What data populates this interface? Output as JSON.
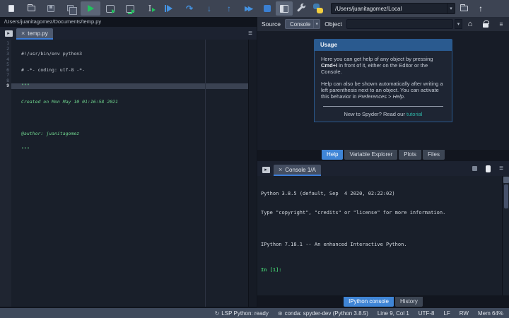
{
  "icons": {
    "dropdown": "▾",
    "menu": "≡",
    "home": "⌂",
    "close": "×",
    "curved_arrow": "↷",
    "arrow_down": "↓",
    "arrow_up": "↑",
    "fast_forward": "▶▶",
    "ibeam": "I",
    "browse_arrow": "▸",
    "lsp": "↻",
    "conda": "⊛"
  },
  "toolbar": {
    "path_value": "/Users/juanitagomez/Local"
  },
  "editor": {
    "path": "/Users/juanitagomez/Documents/temp.py",
    "tab_label": "temp.py",
    "lines": [
      {
        "num": "1",
        "text": "#!/usr/bin/env python3"
      },
      {
        "num": "2",
        "text": "# -*- coding: utf-8 -*-"
      },
      {
        "num": "3",
        "text": "\"\"\""
      },
      {
        "num": "4",
        "text": "Created on Mon May 10 01:16:58 2021"
      },
      {
        "num": "5",
        "text": ""
      },
      {
        "num": "6",
        "text": "@author: juanitagomez"
      },
      {
        "num": "7",
        "text": "\"\"\""
      },
      {
        "num": "8",
        "text": ""
      },
      {
        "num": "9",
        "text": ""
      }
    ]
  },
  "help": {
    "source_label": "Source",
    "source_value": "Console",
    "object_label": "Object",
    "usage": {
      "title": "Usage",
      "p1_before": "Here you can get help of any object by pressing ",
      "p1_bold": "Cmd+I",
      "p1_after": " in front of it, either on the Editor or the Console.",
      "p2_before": "Help can also be shown automatically after writing a left parenthesis next to an object. You can activate this behavior in ",
      "p2_italic": "Preferences > Help",
      "p2_after": ".",
      "footer_before": "New to Spyder? Read our ",
      "footer_link": "tutorial"
    },
    "tabs": [
      {
        "label": "Help"
      },
      {
        "label": "Variable Explorer"
      },
      {
        "label": "Plots"
      },
      {
        "label": "Files"
      }
    ]
  },
  "console": {
    "tab_label": "Console 1/A",
    "lines": [
      "Python 3.8.5 (default, Sep  4 2020, 02:22:02)",
      "Type \"copyright\", \"credits\" or \"license\" for more information.",
      "",
      "IPython 7.18.1 -- An enhanced Interactive Python."
    ],
    "prompt": "In [1]:",
    "bottom_tabs": [
      {
        "label": "IPython console"
      },
      {
        "label": "History"
      }
    ]
  },
  "statusbar": {
    "lsp": "LSP Python: ready",
    "conda": "conda: spyder-dev (Python 3.8.5)",
    "cursor": "Line 9, Col 1",
    "encoding": "UTF-8",
    "eol": "LF",
    "permissions": "RW",
    "memory": "Mem 64%"
  }
}
